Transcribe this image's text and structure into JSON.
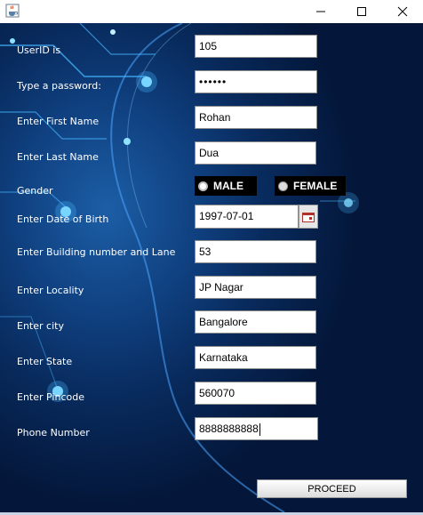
{
  "window": {
    "icon": "java-cup-icon",
    "controls": [
      "minimize-icon",
      "maximize-icon",
      "close-icon"
    ]
  },
  "form": {
    "userid": {
      "label": "UserID is",
      "value": "105"
    },
    "password": {
      "label": "Type a password:",
      "value": "••••••"
    },
    "first_name": {
      "label": "Enter First Name",
      "value": "Rohan"
    },
    "last_name": {
      "label": "Enter Last Name",
      "value": "Dua"
    },
    "gender": {
      "label": "Gender",
      "options": [
        "MALE",
        "FEMALE"
      ],
      "selected": "MALE"
    },
    "dob": {
      "label": "Enter Date of Birth",
      "value": "1997-07-01"
    },
    "building": {
      "label": "Enter Building number and Lane",
      "value": "53"
    },
    "locality": {
      "label": "Enter Locality",
      "value": "JP Nagar"
    },
    "city": {
      "label": "Enter city",
      "value": "Bangalore"
    },
    "state": {
      "label": "Enter State",
      "value": "Karnataka"
    },
    "pincode": {
      "label": "Enter Pincode",
      "value": "560070"
    },
    "phone": {
      "label": "Phone Number",
      "value": "8888888888"
    }
  },
  "actions": {
    "proceed_label": "PROCEED"
  },
  "colors": {
    "background": "#0a3270",
    "radio_bg": "#000000",
    "label_text": "#ffffff"
  }
}
